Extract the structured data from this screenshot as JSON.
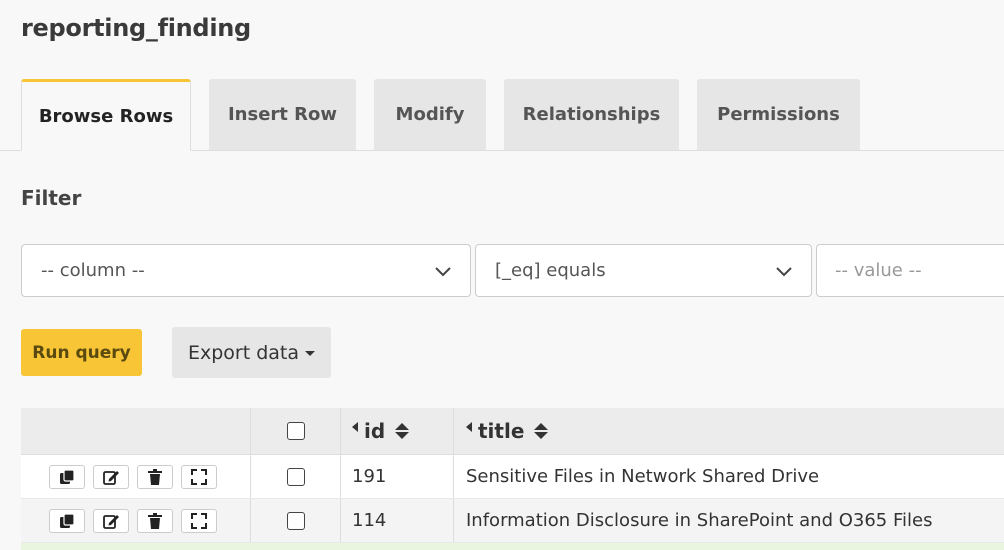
{
  "page": {
    "title": "reporting_finding"
  },
  "tabs": [
    {
      "label": "Browse Rows",
      "active": true
    },
    {
      "label": "Insert Row",
      "active": false
    },
    {
      "label": "Modify",
      "active": false
    },
    {
      "label": "Relationships",
      "active": false
    },
    {
      "label": "Permissions",
      "active": false
    }
  ],
  "filter": {
    "label": "Filter",
    "column_select": "-- column --",
    "operator_select": "[_eq] equals",
    "value_placeholder": "-- value --"
  },
  "actions": {
    "run_query": "Run query",
    "export_data": "Export data"
  },
  "table": {
    "columns": [
      "id",
      "title"
    ],
    "rows": [
      {
        "id": "191",
        "title": "Sensitive Files in Network Shared Drive"
      },
      {
        "id": "114",
        "title": "Information Disclosure in SharePoint and O365 Files"
      }
    ]
  },
  "colors": {
    "accent": "#f7c535",
    "tab_inactive": "#e6e6e6",
    "row_highlight": "#e9f5df"
  },
  "icons": {
    "row_actions": [
      "clone-icon",
      "edit-icon",
      "delete-icon",
      "expand-icon"
    ]
  }
}
